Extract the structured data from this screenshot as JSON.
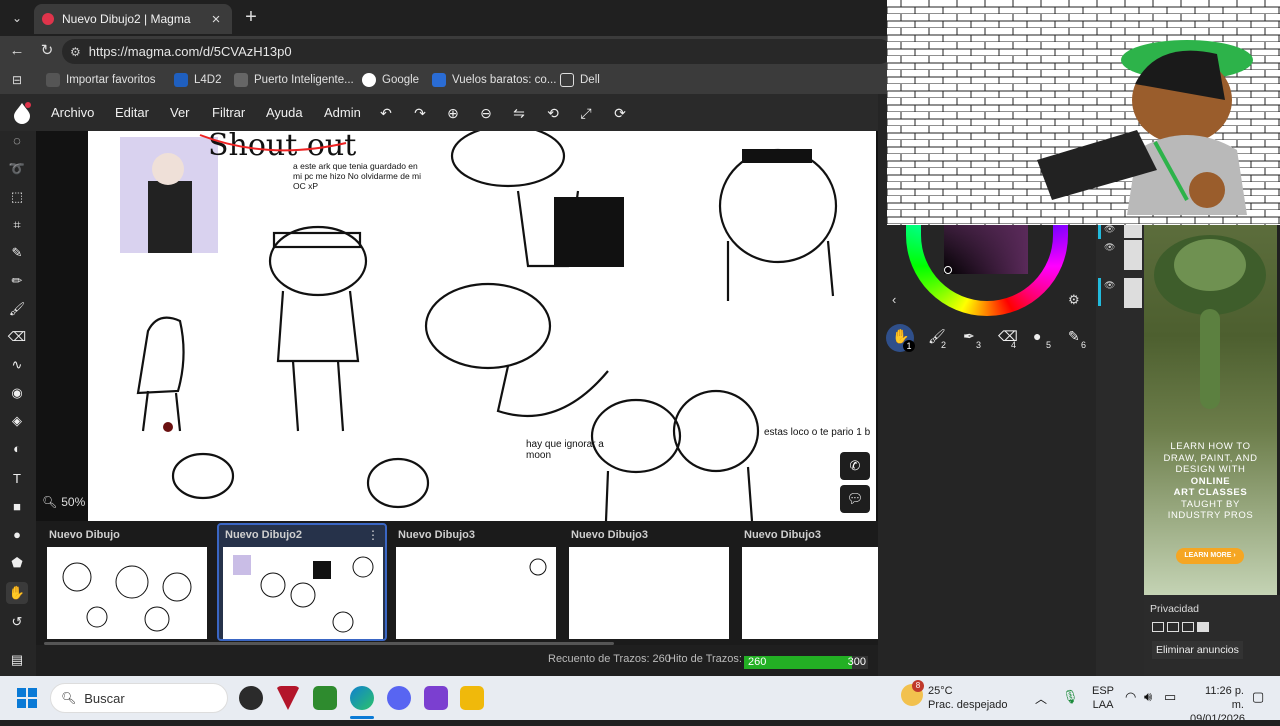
{
  "browser": {
    "tab_title": "Nuevo Dibujo2 | Magma",
    "close_glyph": "×",
    "newtab_glyph": "+",
    "url": "https://magma.com/d/5CVAzH13p0",
    "bookmarks": [
      "Importar favoritos",
      "L4D2",
      "Puerto Inteligente...",
      "Google",
      "Vuelos baratos: co...",
      "Dell"
    ]
  },
  "app": {
    "menu": [
      "Archivo",
      "Editar",
      "Ver",
      "Filtrar",
      "Ayuda",
      "Admin"
    ],
    "zoom_label": "50%",
    "documents": [
      {
        "title": "Nuevo Dibujo",
        "selected": false
      },
      {
        "title": "Nuevo Dibujo2",
        "selected": true
      },
      {
        "title": "Nuevo Dibujo3",
        "selected": false
      },
      {
        "title": "Nuevo Dibujo3",
        "selected": false
      },
      {
        "title": "Nuevo Dibujo3",
        "selected": false
      }
    ],
    "status": {
      "stroke_count_label": "Recuento de Trazos: 260",
      "stroke_limit_label": "Hito de Trazos:",
      "progress_value": "260",
      "progress_max": "300",
      "progress_fraction": 0.867
    },
    "brush_slots": [
      "1",
      "2",
      "3",
      "4",
      "5",
      "6"
    ],
    "canvas_text": {
      "shoutout": "Shout out",
      "note1": "a este ark que tenia guardado en mi pc me hizo No olvidarme de mi OC xP",
      "note2": "hay que ignorar a moon",
      "note3": "estas loco o te pario 1 b"
    }
  },
  "ad": {
    "line1": "LEARN HOW TO",
    "line2": "DRAW, PAINT, AND",
    "line3": "DESIGN WITH",
    "line4": "ONLINE",
    "line5": "ART CLASSES",
    "line6": "TAUGHT BY",
    "line7": "INDUSTRY PROS",
    "cta": "LEARN MORE ›",
    "privacy": "Privacidad",
    "remove_ads": "Eliminar anuncios"
  },
  "taskbar": {
    "search_placeholder": "Buscar",
    "weather_temp": "25°C",
    "weather_desc": "Prac. despejado",
    "weather_badge": "8",
    "lang1": "ESP",
    "lang2": "LAA",
    "time": "11:26 p. m.",
    "date": "09/01/2026"
  },
  "colors": {
    "accent_blue": "#3a66c4",
    "progress_green": "#23b024",
    "ad_button": "#f5a623",
    "app_dark": "#2a2a2a"
  }
}
